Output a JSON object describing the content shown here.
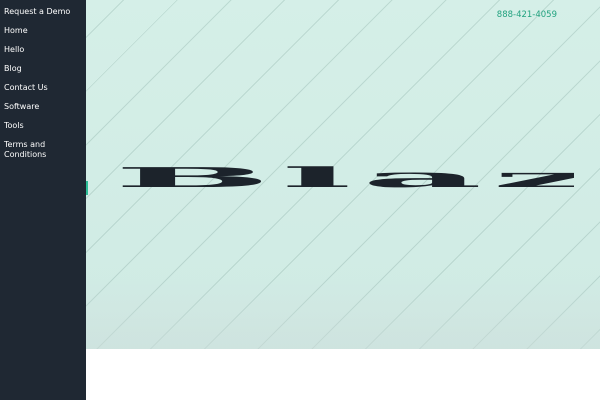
{
  "nav": {
    "items": [
      {
        "label": "Request a Demo"
      },
      {
        "label": "Home"
      },
      {
        "label": "Hello"
      },
      {
        "label": "Blog"
      },
      {
        "label": "Contact Us"
      },
      {
        "label": "Software"
      },
      {
        "label": "Tools"
      },
      {
        "label": "Terms and Conditions"
      }
    ]
  },
  "header": {
    "phone": "888-421-4059"
  },
  "hero": {
    "logo_text": "Blaze"
  },
  "colors": {
    "sidebar_bg": "#1f2833",
    "accent": "#22a27f",
    "hero_bg": "#e8f7f3",
    "logo": "#1c232b"
  }
}
